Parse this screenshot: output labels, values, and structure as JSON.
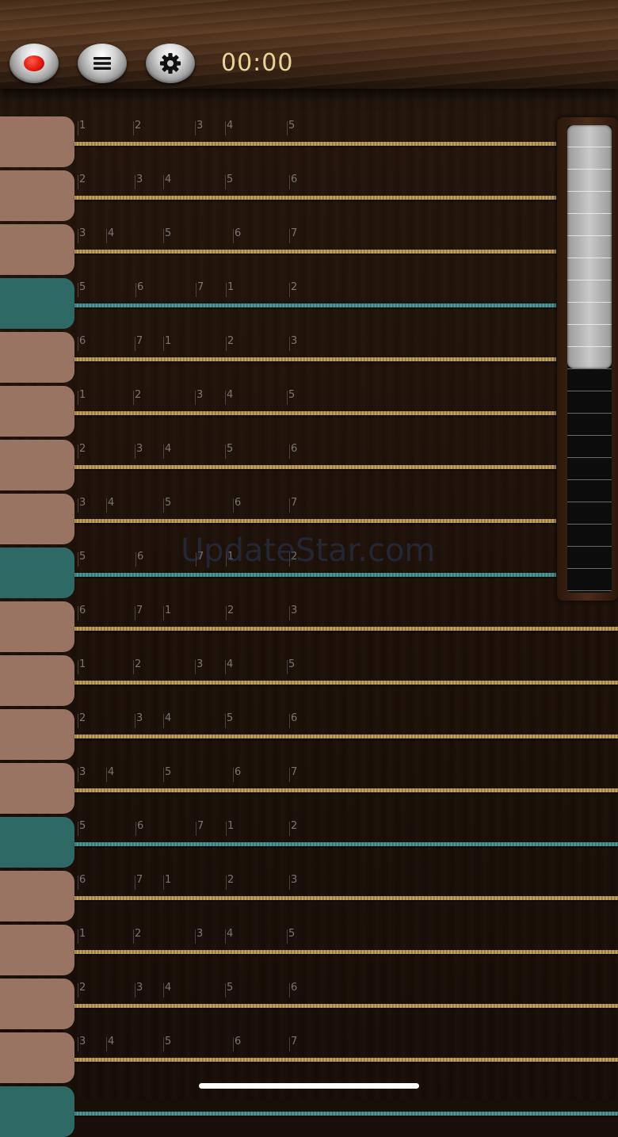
{
  "toolbar": {
    "timer": "00:00",
    "record_icon": "record-icon",
    "menu_icon": "menu-icon",
    "settings_icon": "gear-icon"
  },
  "watermark": "UpdateStar.com",
  "colors": {
    "string_gold": "#c4a55c",
    "string_teal": "#4f9a9a",
    "key_brown": "#9a7462",
    "key_teal": "#2f6966",
    "timer_text": "#e9d49a",
    "record_red": "#e01a10"
  },
  "rows": [
    {
      "teal": false,
      "notes": [
        "1",
        "2",
        "3",
        "4",
        "5"
      ]
    },
    {
      "teal": false,
      "notes": [
        "2",
        "3",
        "4",
        "5",
        "6"
      ]
    },
    {
      "teal": false,
      "notes": [
        "3",
        "4",
        "5",
        "6",
        "7"
      ]
    },
    {
      "teal": true,
      "notes": [
        "5",
        "6",
        "7",
        "1",
        "2"
      ]
    },
    {
      "teal": false,
      "notes": [
        "6",
        "7",
        "1",
        "2",
        "3"
      ]
    },
    {
      "teal": false,
      "notes": [
        "1",
        "2",
        "3",
        "4",
        "5"
      ]
    },
    {
      "teal": false,
      "notes": [
        "2",
        "3",
        "4",
        "5",
        "6"
      ]
    },
    {
      "teal": false,
      "notes": [
        "3",
        "4",
        "5",
        "6",
        "7"
      ]
    },
    {
      "teal": true,
      "notes": [
        "5",
        "6",
        "7",
        "1",
        "2"
      ]
    },
    {
      "teal": false,
      "notes": [
        "6",
        "7",
        "1",
        "2",
        "3"
      ]
    },
    {
      "teal": false,
      "notes": [
        "1",
        "2",
        "3",
        "4",
        "5"
      ]
    },
    {
      "teal": false,
      "notes": [
        "2",
        "3",
        "4",
        "5",
        "6"
      ]
    },
    {
      "teal": false,
      "notes": [
        "3",
        "4",
        "5",
        "6",
        "7"
      ]
    },
    {
      "teal": true,
      "notes": [
        "5",
        "6",
        "7",
        "1",
        "2"
      ]
    },
    {
      "teal": false,
      "notes": [
        "6",
        "7",
        "1",
        "2",
        "3"
      ]
    },
    {
      "teal": false,
      "notes": [
        "1",
        "2",
        "3",
        "4",
        "5"
      ]
    },
    {
      "teal": false,
      "notes": [
        "2",
        "3",
        "4",
        "5",
        "6"
      ]
    },
    {
      "teal": false,
      "notes": [
        "3",
        "4",
        "5",
        "6",
        "7"
      ]
    },
    {
      "teal": true,
      "notes": []
    }
  ],
  "scroll": {
    "thumb_fraction": 0.52
  }
}
